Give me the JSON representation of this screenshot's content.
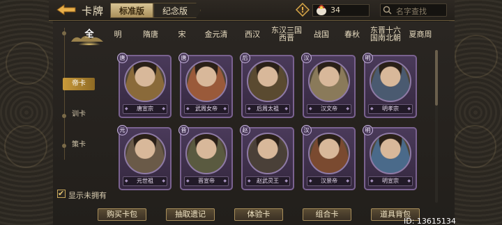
{
  "header": {
    "title": "卡牌",
    "version_tabs": [
      {
        "label": "标准版",
        "active": true
      },
      {
        "label": "纪念版",
        "active": false
      }
    ],
    "currency_count": "34",
    "search_placeholder": "名字查找"
  },
  "era_tabs": [
    {
      "label": "全",
      "active": true
    },
    {
      "label": "明"
    },
    {
      "label": "隋唐"
    },
    {
      "label": "宋"
    },
    {
      "label": "金元清"
    },
    {
      "label": "西汉"
    },
    {
      "label": "东汉三国 西晋"
    },
    {
      "label": "战国"
    },
    {
      "label": "春秋"
    },
    {
      "label": "东晋十六 国南北朝"
    },
    {
      "label": "夏商周"
    }
  ],
  "side_tabs": [
    {
      "label": "帝卡",
      "active": true
    },
    {
      "label": "训卡"
    },
    {
      "label": "策卡"
    }
  ],
  "cards": [
    {
      "badge": "唐",
      "name": "唐宣宗",
      "tone": "#8a6a3a"
    },
    {
      "badge": "唐",
      "name": "武周女帝",
      "tone": "#9a5a3a"
    },
    {
      "badge": "后",
      "name": "后周太祖",
      "tone": "#5a4a30"
    },
    {
      "badge": "汉",
      "name": "汉文帝",
      "tone": "#8a7a5a"
    },
    {
      "badge": "明",
      "name": "明孝宗",
      "tone": "#4a5a70"
    },
    {
      "badge": "元",
      "name": "元世祖",
      "tone": "#6a5a48"
    },
    {
      "badge": "晋",
      "name": "晋宣帝",
      "tone": "#5a5a40"
    },
    {
      "badge": "赵",
      "name": "赵武灵王",
      "tone": "#4a4038"
    },
    {
      "badge": "汉",
      "name": "汉景帝",
      "tone": "#7a4a30"
    },
    {
      "badge": "明",
      "name": "明宣宗",
      "tone": "#4a6a8a"
    }
  ],
  "show_unowned_label": "显示未拥有",
  "actions": [
    {
      "label": "购买卡包"
    },
    {
      "label": "抽取遗记"
    },
    {
      "label": "体验卡"
    },
    {
      "label": "组合卡"
    },
    {
      "label": "道具背包"
    }
  ],
  "user_id": "ID: 13615134"
}
